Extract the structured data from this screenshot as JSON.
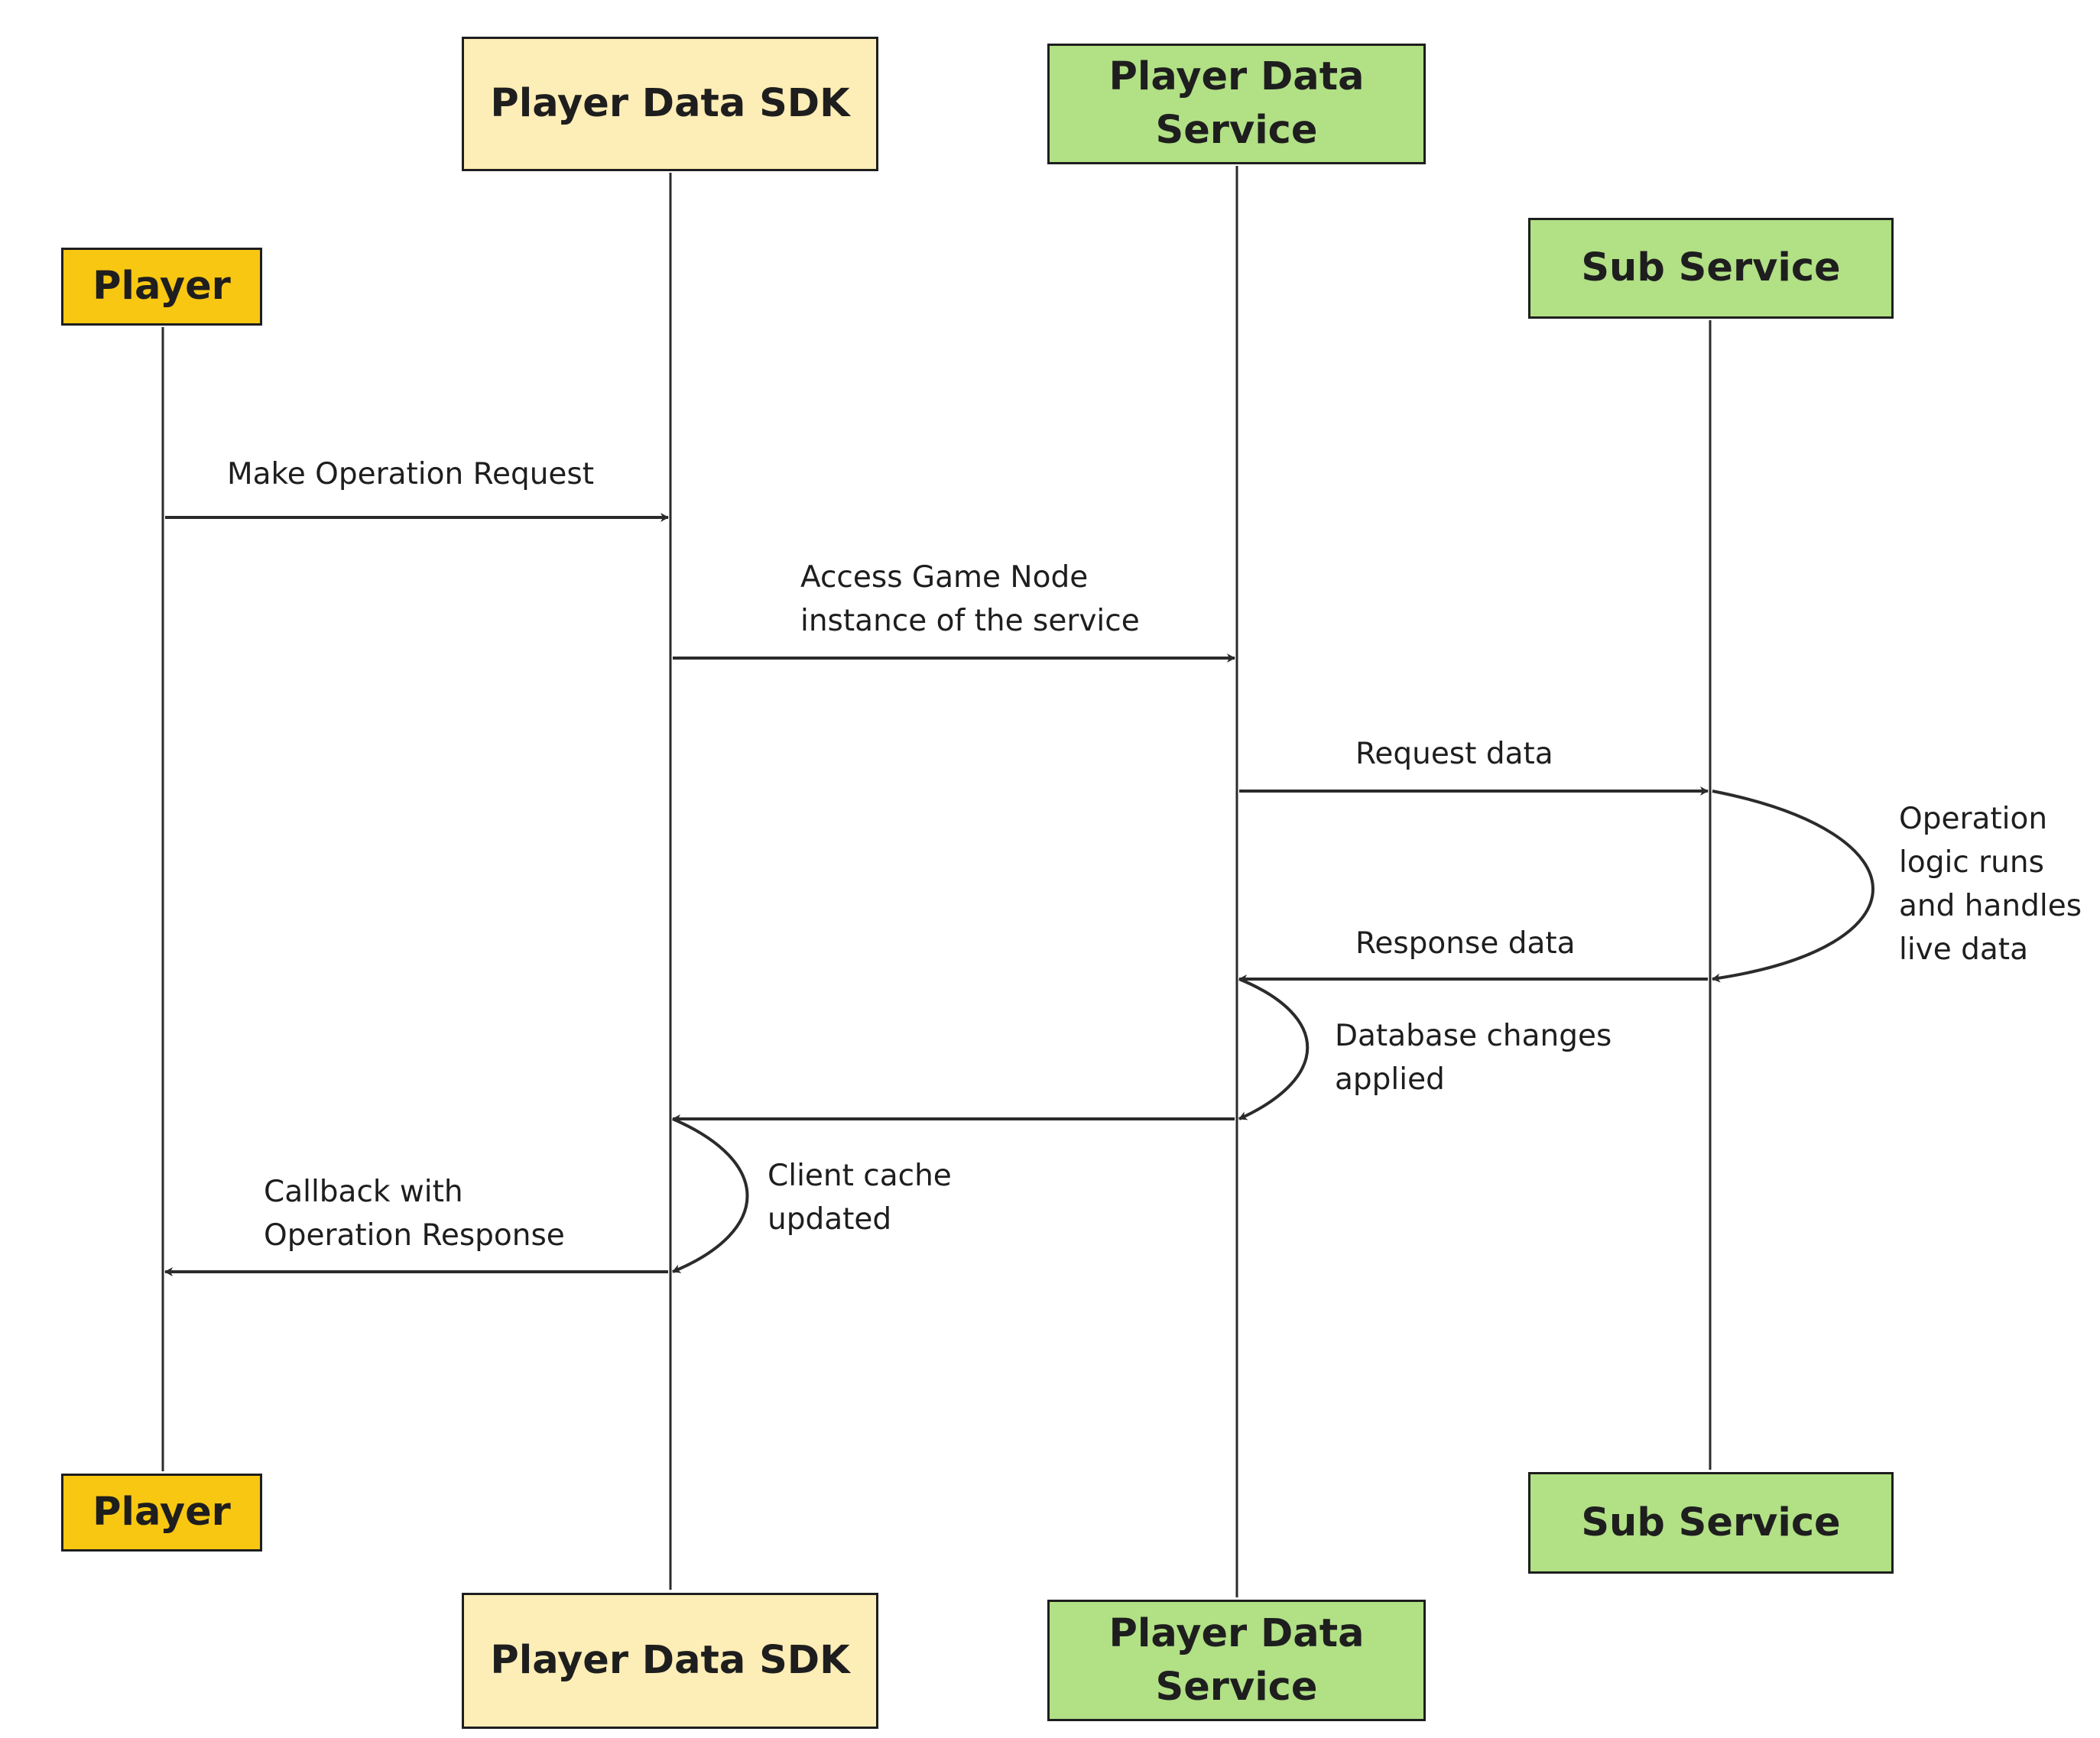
{
  "diagram": {
    "type": "sequence",
    "colors": {
      "player": "#f8c712",
      "sdk": "#fdedb6",
      "service": "#b1e085",
      "stroke": "#2b2b2b"
    },
    "participants": [
      {
        "id": "player",
        "label": "Player"
      },
      {
        "id": "sdk",
        "label": "Player Data SDK"
      },
      {
        "id": "pds",
        "label": "Player Data\nService"
      },
      {
        "id": "sub",
        "label": "Sub Service"
      }
    ],
    "messages": [
      {
        "from": "player",
        "to": "sdk",
        "label": "Make Operation Request"
      },
      {
        "from": "sdk",
        "to": "pds",
        "label": "Access Game Node\ninstance of the service"
      },
      {
        "from": "pds",
        "to": "sub",
        "label": "Request data"
      },
      {
        "from": "sub",
        "to": "sub",
        "label": "Operation\nlogic runs\nand handles\nlive data"
      },
      {
        "from": "sub",
        "to": "pds",
        "label": "Response data"
      },
      {
        "from": "pds",
        "to": "pds",
        "label": "Database changes\napplied"
      },
      {
        "from": "pds",
        "to": "sdk",
        "label": ""
      },
      {
        "from": "sdk",
        "to": "sdk",
        "label": "Client cache\nupdated"
      },
      {
        "from": "sdk",
        "to": "player",
        "label": "Callback with\nOperation Response"
      }
    ]
  }
}
